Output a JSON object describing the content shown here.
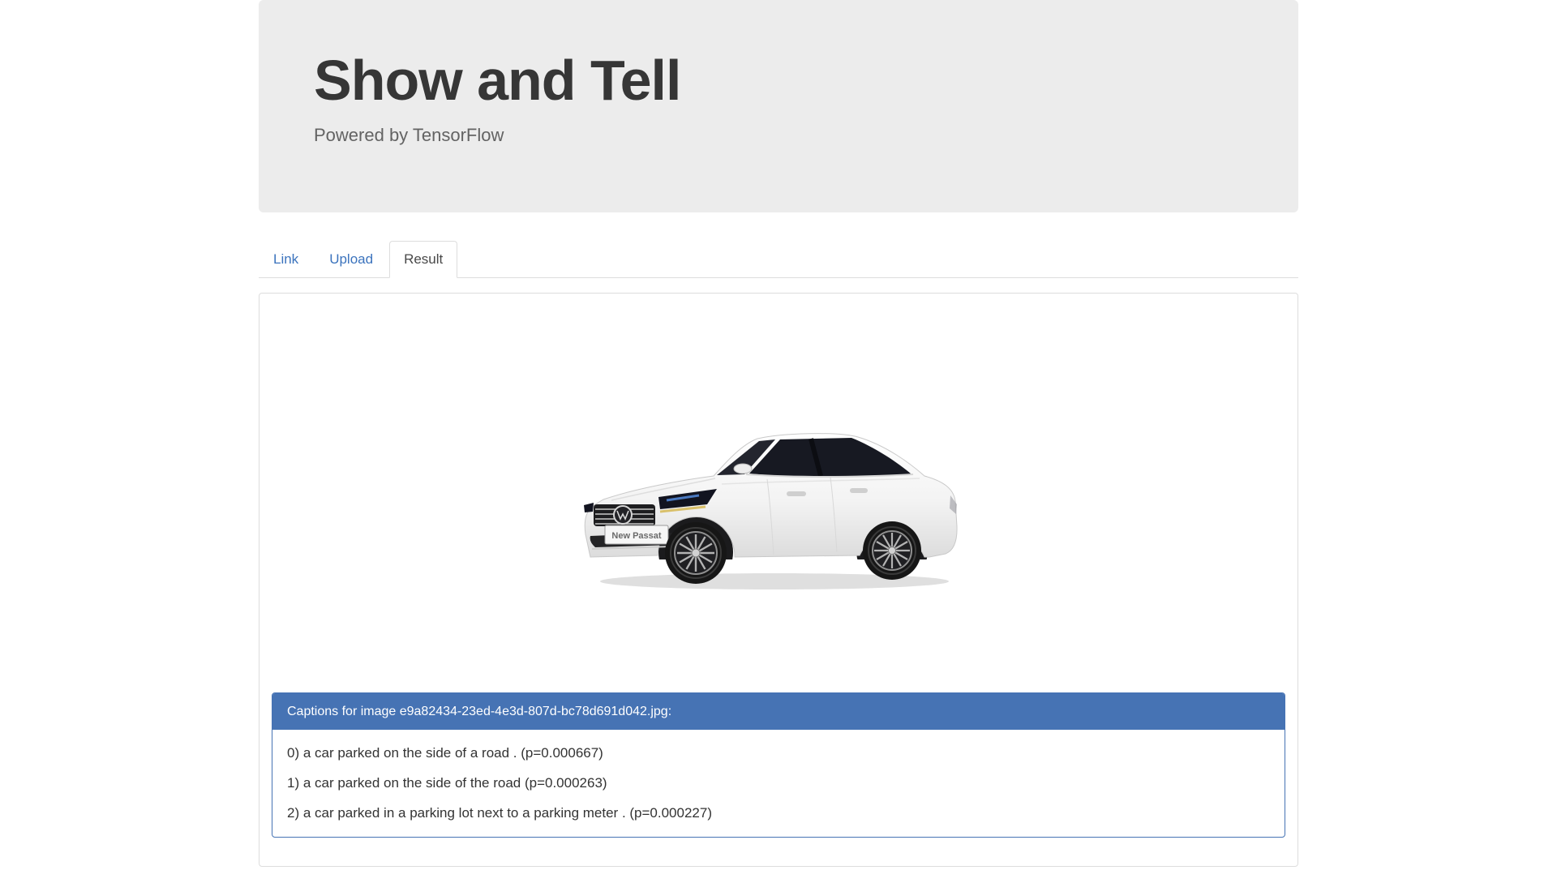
{
  "hero": {
    "title": "Show and Tell",
    "subtitle": "Powered by TensorFlow"
  },
  "tabs": [
    {
      "label": "Link",
      "active": false
    },
    {
      "label": "Upload",
      "active": false
    },
    {
      "label": "Result",
      "active": true
    }
  ],
  "result": {
    "image": {
      "badge": "New Passat"
    },
    "captions_panel": {
      "header": "Captions for image e9a82434-23ed-4e3d-807d-bc78d691d042.jpg:",
      "captions": [
        "0) a car parked on the side of a road . (p=0.000667)",
        "1) a car parked on the side of the road (p=0.000263)",
        "2) a car parked in a parking lot next to a parking meter . (p=0.000227)"
      ]
    }
  },
  "colors": {
    "accent_blue": "#4673b4",
    "link_blue": "#3b73bd",
    "hero_bg": "#ececec",
    "tab_border": "#dddddd"
  }
}
